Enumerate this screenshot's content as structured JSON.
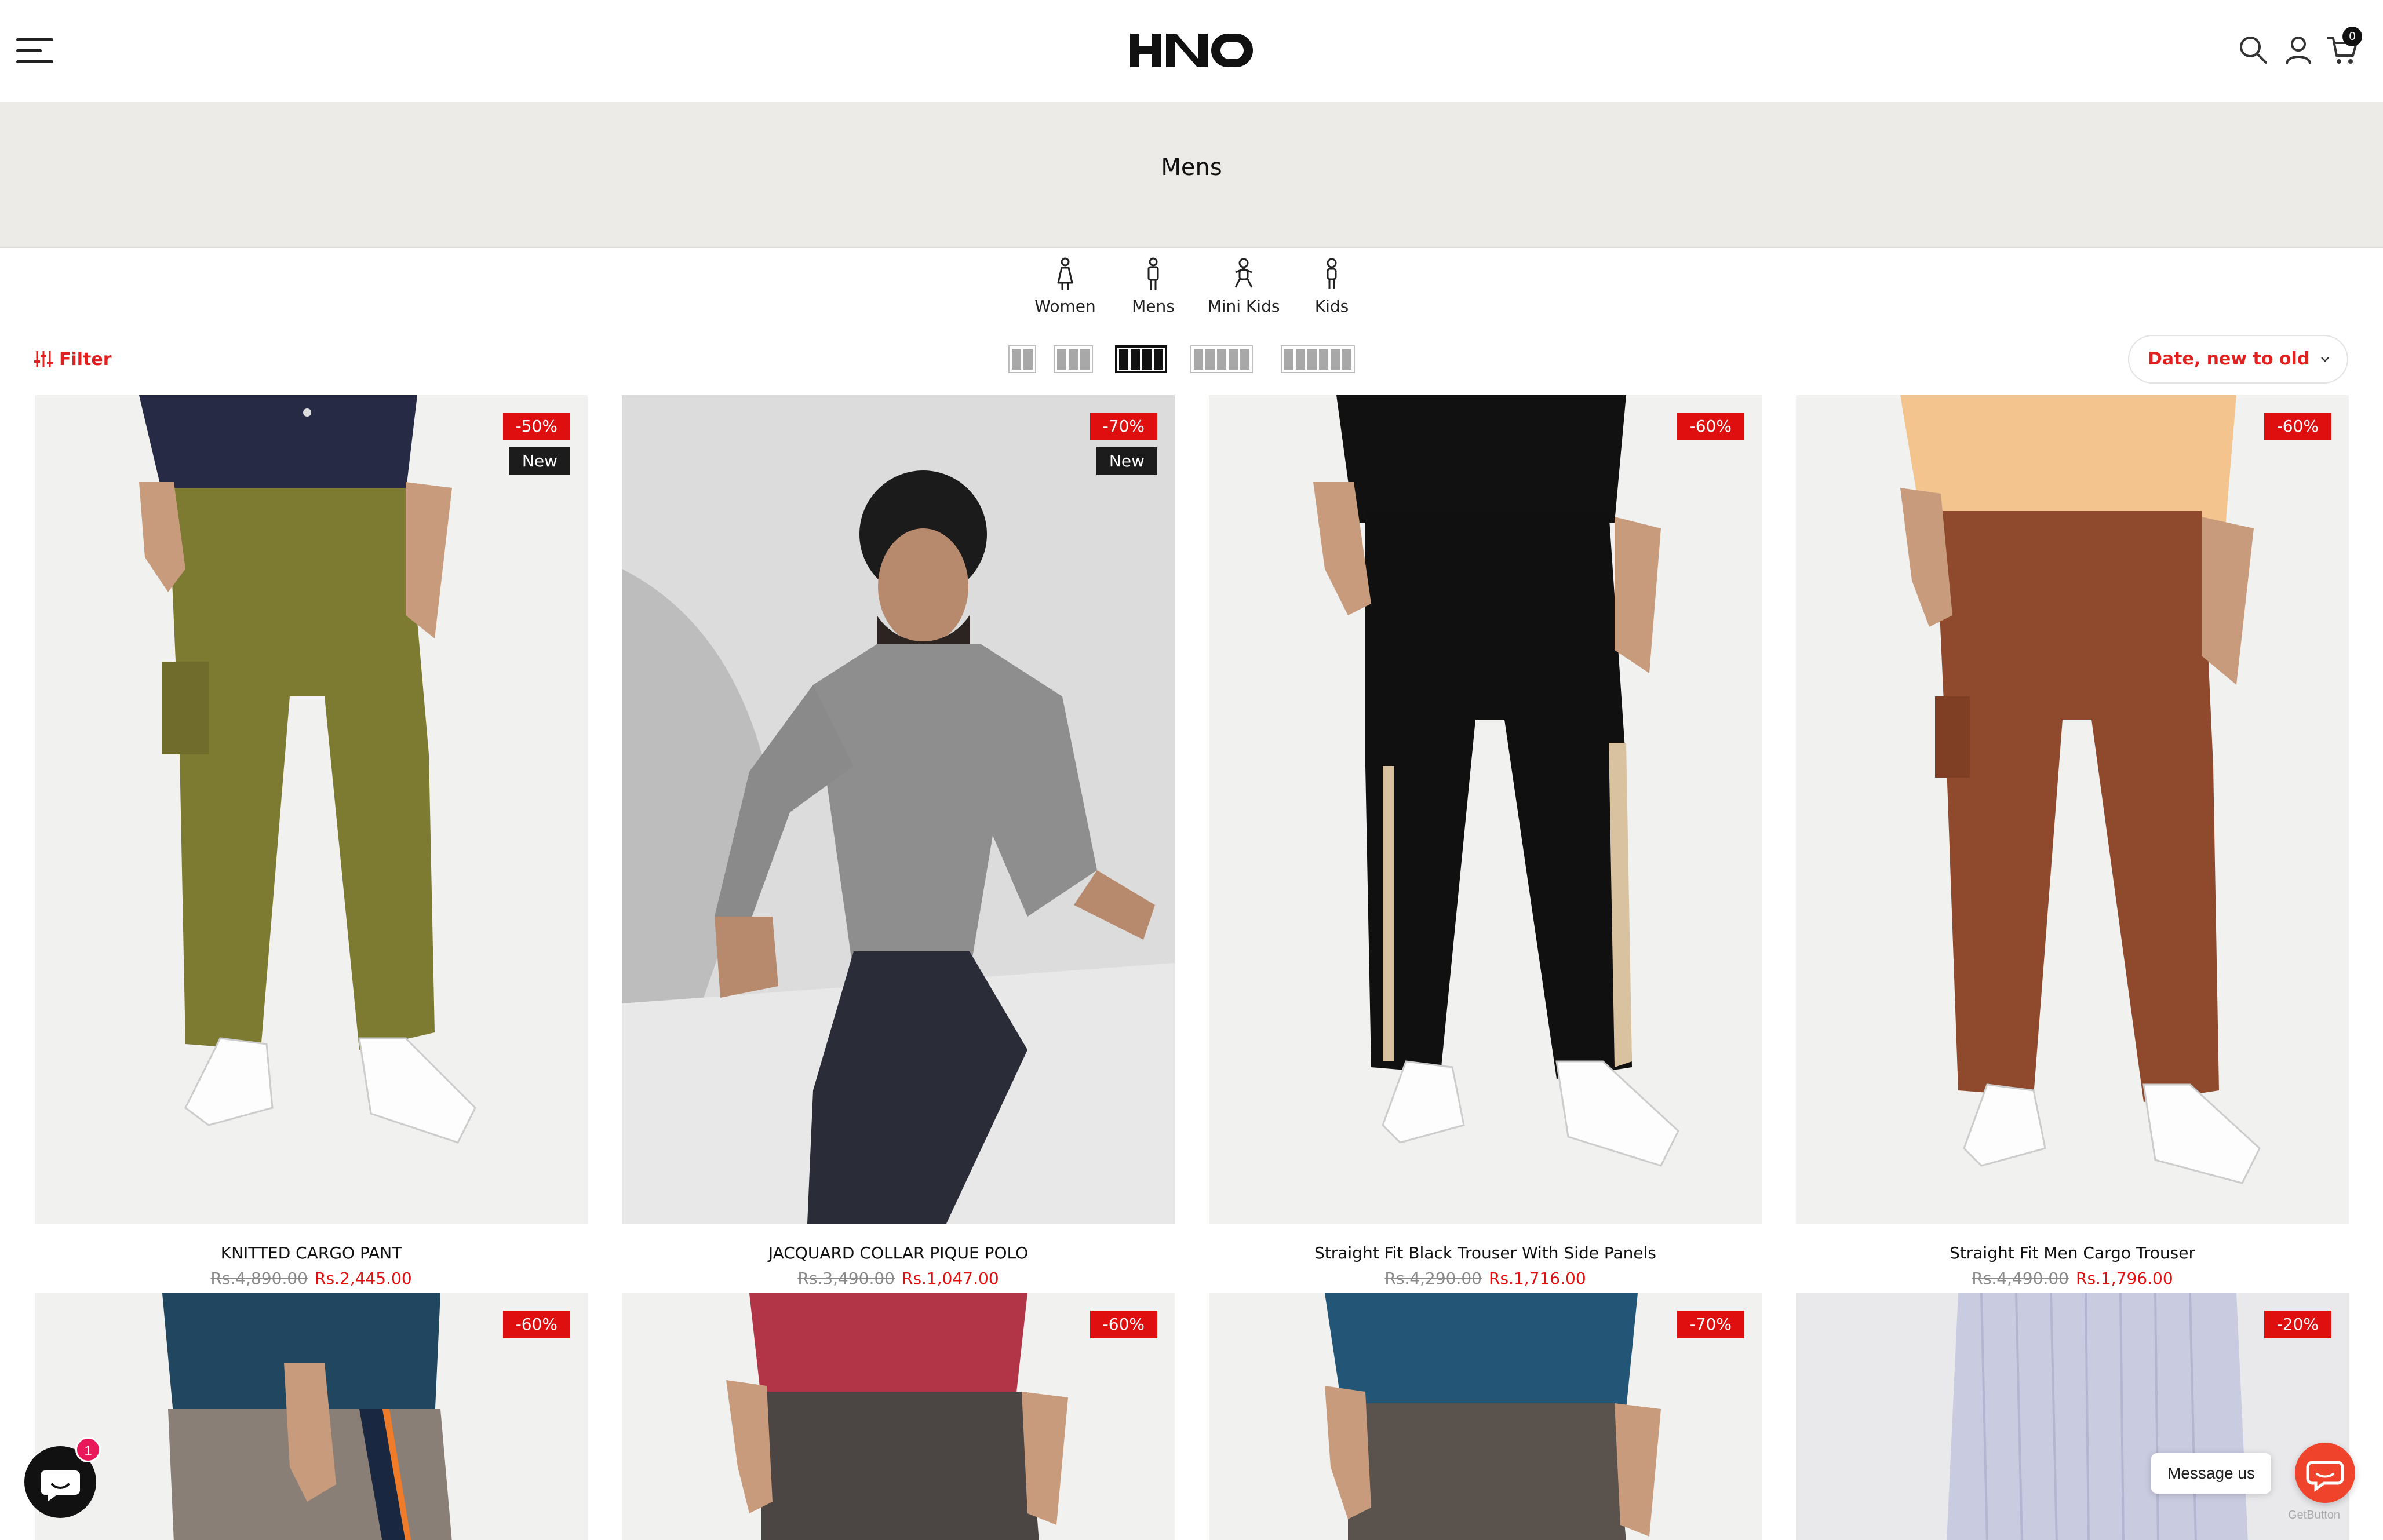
{
  "header": {
    "logo_text": "HNO",
    "cart_count": "0"
  },
  "banner": {
    "title": "Mens"
  },
  "categories": [
    {
      "label": "Women"
    },
    {
      "label": "Mens"
    },
    {
      "label": "Mini Kids"
    },
    {
      "label": "Kids"
    }
  ],
  "toolbar": {
    "filter_label": "Filter",
    "sort_label": "Date, new to old",
    "grid_options": [
      2,
      3,
      4,
      5,
      6
    ],
    "grid_active": 4
  },
  "colors": {
    "accent": "#e32020",
    "sale_badge": "#e00f0f",
    "new_badge": "#1c1c1c",
    "banner": "#ecebe8"
  },
  "products": [
    {
      "title": "KNITTED CARGO PANT",
      "old_price": "Rs.4,890.00",
      "price": "Rs.2,445.00",
      "discount": "-50%",
      "new": "New"
    },
    {
      "title": "JACQUARD COLLAR PIQUE POLO",
      "old_price": "Rs.3,490.00",
      "price": "Rs.1,047.00",
      "discount": "-70%",
      "new": "New"
    },
    {
      "title": "Straight Fit Black Trouser With Side Panels",
      "old_price": "Rs.4,290.00",
      "price": "Rs.1,716.00",
      "discount": "-60%"
    },
    {
      "title": "Straight Fit Men Cargo Trouser",
      "old_price": "Rs.4,490.00",
      "price": "Rs.1,796.00",
      "discount": "-60%"
    }
  ],
  "products_row2": [
    {
      "discount": "-60%"
    },
    {
      "discount": "-60%"
    },
    {
      "discount": "-70%"
    },
    {
      "discount": "-20%"
    }
  ],
  "floating": {
    "chat_badge": "1",
    "message_label": "Message us",
    "getbutton_label": "GetButton"
  }
}
